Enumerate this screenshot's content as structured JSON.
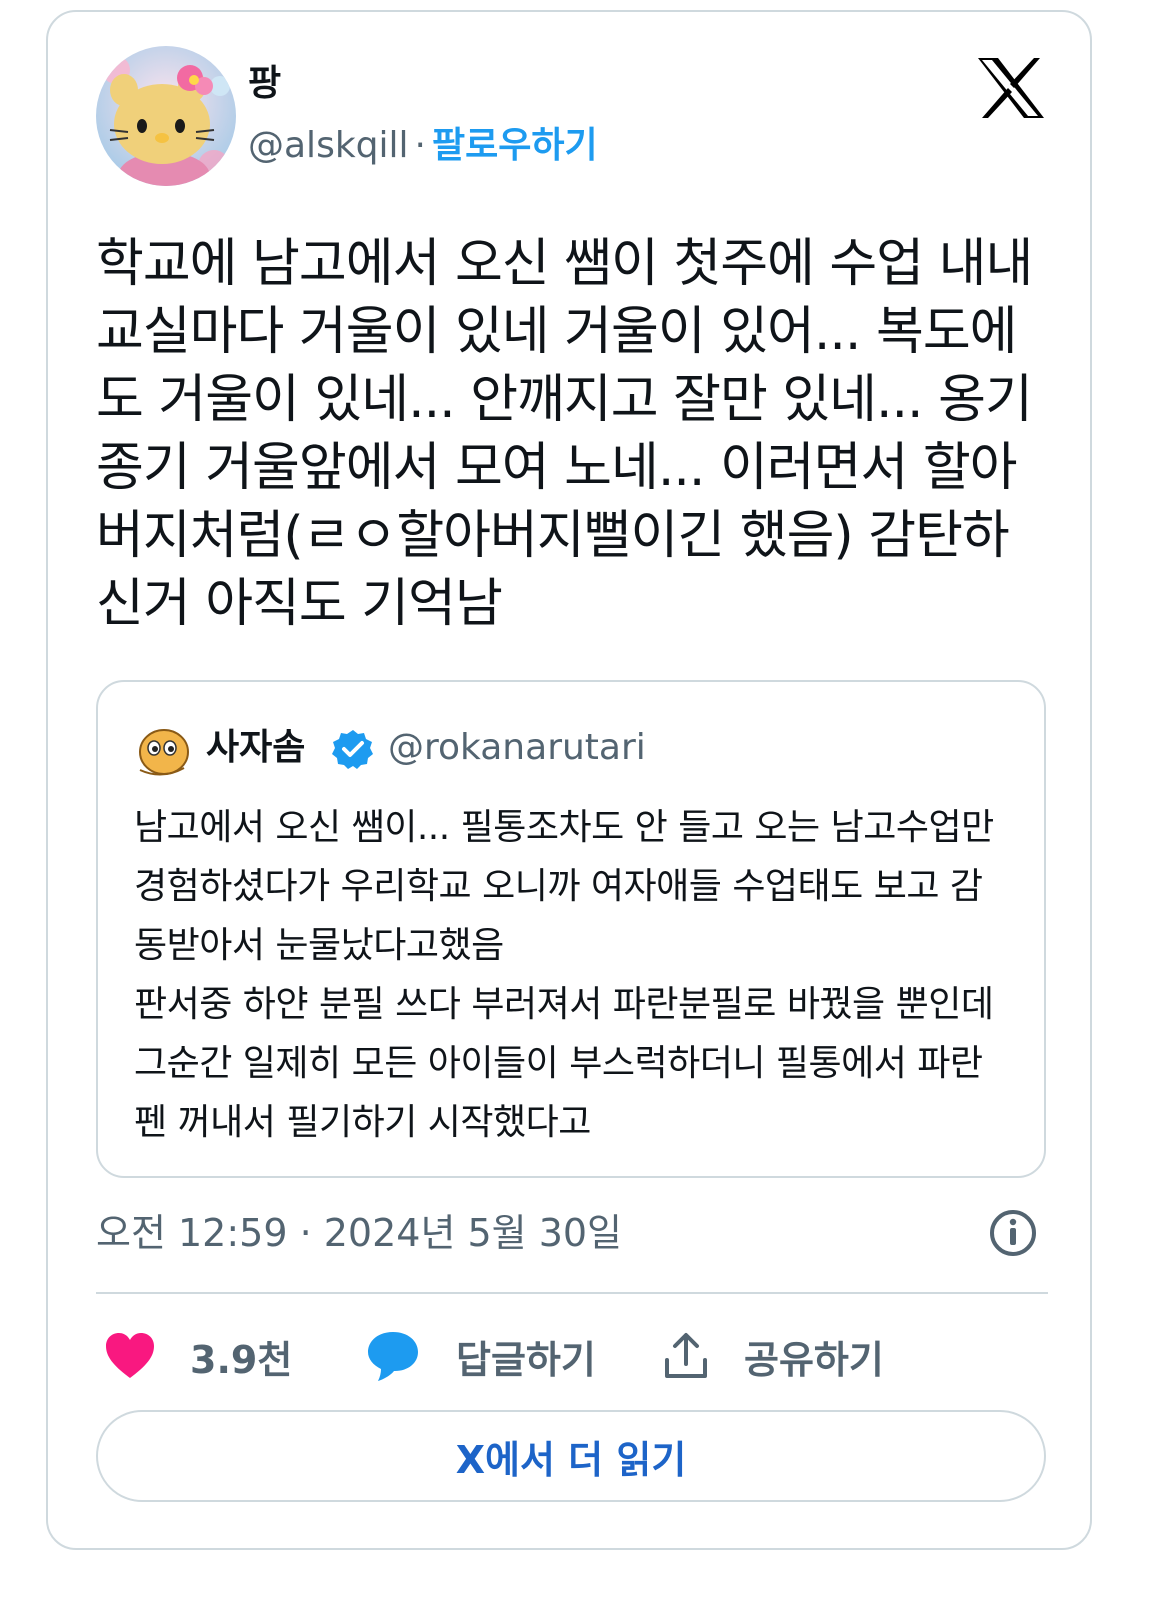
{
  "author": {
    "display_name": "팡",
    "handle": "@alskqill",
    "separator": "·",
    "follow_label": "팔로우하기"
  },
  "tweet": {
    "text": "학교에 남고에서 오신 쌤이 첫주에 수업 내내 교실마다 거울이 있네 거울이 있어... 복도에도 거울이 있네... 안깨지고 잘만 있네... 옹기종기 거울앞에서 모여 노네... 이러면서 할아버지처럼(ㄹㅇ할아버지뻘이긴 했음) 감탄하신거 아직도 기억남",
    "timestamp": "오전 12:59 · 2024년 5월 30일"
  },
  "quote": {
    "display_name": "사자솜",
    "handle": "@rokanarutari",
    "paragraph1": "남고에서 오신 쌤이... 필통조차도 안 들고 오는 남고수업만 경험하셨다가 우리학교 오니까 여자애들 수업태도 보고 감동받아서 눈물났다고했음",
    "paragraph2": "판서중 하얀 분필 쓰다 부러져서 파란분필로 바꿨을 뿐인데 그순간 일제히 모든 아이들이 부스럭하더니 필통에서 파란펜 꺼내서 필기하기 시작했다고"
  },
  "actions": {
    "like_count": "3.9천",
    "reply_label": "답글하기",
    "share_label": "공유하기"
  },
  "read_more_label": "X에서 더 읽기",
  "icons": {
    "logo": "x-logo-icon",
    "verified": "verified-badge-icon",
    "info": "info-icon",
    "like": "heart-icon",
    "reply": "speech-bubble-icon",
    "share": "share-upload-icon"
  },
  "colors": {
    "accent": "#1d9bf0",
    "like": "#f91880",
    "text": "#0f1419",
    "muted": "#536471",
    "border": "#cfd9de"
  }
}
